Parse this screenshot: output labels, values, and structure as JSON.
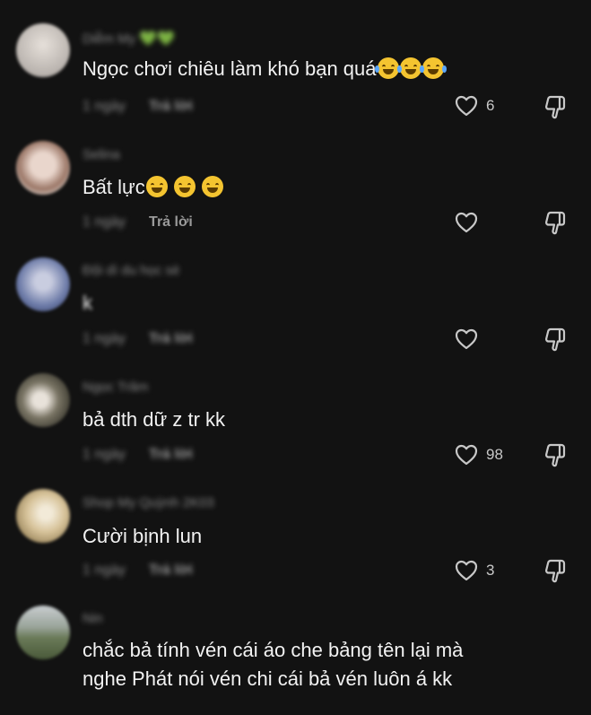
{
  "comments": [
    {
      "username": "Diễm My",
      "username_suffix": "💚💚",
      "text": "Ngọc chơi chiêu làm khó bạn quá",
      "emoji": [
        "laugh-crying-emoji",
        "laugh-crying-emoji",
        "laugh-crying-emoji"
      ],
      "time": "1 ngày",
      "reply": "Trả lời",
      "likes": "6",
      "avatar_color": "#d8d4d0"
    },
    {
      "username": "Selina",
      "text": "Bất lực",
      "emoji": [
        "grinning-squint-emoji",
        "grinning-squint-emoji",
        "grinning-squint-emoji"
      ],
      "time": "1 ngày",
      "reply": "Trả lời",
      "likes": "",
      "avatar_color": "#c9a898"
    },
    {
      "username": "Đội dì du học sè",
      "text": "k",
      "time": "1 ngày",
      "reply": "Trả lời",
      "likes": "",
      "avatar_color": "#7f8fb5"
    },
    {
      "username": "Ngọc Trâm",
      "text": "bả dth dữ z tr kk",
      "time": "1 ngày",
      "reply": "Trả lời",
      "likes": "98",
      "avatar_color": "#6b6a5a"
    },
    {
      "username": "Shop My Quỳnh 2K03",
      "text": "Cười bịnh lun",
      "time": "1 ngày",
      "reply": "Trả lời",
      "likes": "3",
      "avatar_color": "#d7c39a"
    },
    {
      "username": "Nin",
      "text_lines": [
        "chắc bả tính vén cái áo che bảng tên lại mà",
        "nghe Phát nói vén chi cái bả vén luôn á kk"
      ],
      "avatar_color": "#8d9b7a"
    }
  ]
}
